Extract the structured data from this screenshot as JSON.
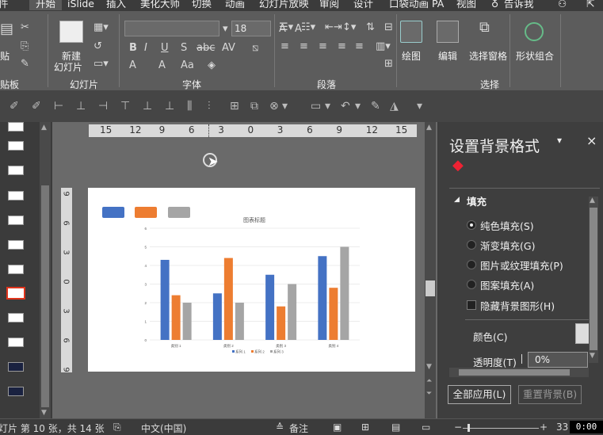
{
  "tabs": [
    "件",
    "开始",
    "iSlide",
    "插入",
    "美化大师",
    "切换",
    "动画",
    "幻灯片放映",
    "审阅",
    "设计",
    "口袋动画 PA",
    "视图",
    "告诉我"
  ],
  "ribbon": {
    "clipboard": {
      "paste": "贴",
      "label": "贴板"
    },
    "slides": {
      "new_slide": "新建",
      "new_slide2": "幻灯片",
      "label": "幻灯片"
    },
    "font": {
      "size": "18",
      "label": "字体",
      "bold": "B",
      "italic": "I",
      "underline": "U",
      "shadow": "S",
      "strike": "abc",
      "spacing": "AV",
      "case": "Aa",
      "color_a": "A",
      "grow": "A",
      "shrink": "A"
    },
    "paragraph": {
      "label": "段落"
    },
    "drawing": {
      "draw": "绘图",
      "edit": "编辑",
      "select_pane": "选择窗格",
      "group": "形状组合",
      "label": "选择"
    }
  },
  "ruler": {
    "h_ticks": [
      "15",
      "12",
      "9",
      "6",
      "3",
      "0",
      "3",
      "6",
      "9",
      "12",
      "15"
    ],
    "v_ticks": [
      "9",
      "6",
      "3",
      "0",
      "3",
      "6",
      "9"
    ]
  },
  "slide": {
    "legend_swatch_colors": [
      "#4472c4",
      "#ed7d31",
      "#a5a5a5"
    ]
  },
  "chart_data": {
    "type": "bar",
    "title": "图表标题",
    "categories": [
      "类别 1",
      "类别 2",
      "类别 3",
      "类别 4"
    ],
    "series": [
      {
        "name": "系列 1",
        "values": [
          4.3,
          2.5,
          3.5,
          4.5
        ],
        "color": "#4472c4"
      },
      {
        "name": "系列 2",
        "values": [
          2.4,
          4.4,
          1.8,
          2.8
        ],
        "color": "#ed7d31"
      },
      {
        "name": "系列 3",
        "values": [
          2,
          2,
          3,
          5
        ],
        "color": "#a5a5a5"
      }
    ],
    "yticks": [
      "0",
      "1",
      "2",
      "3",
      "4",
      "5",
      "6"
    ],
    "ylim": [
      0,
      6
    ],
    "grid": true,
    "legend": "bottom"
  },
  "panel": {
    "title": "设置背景格式",
    "section": "填充",
    "options": [
      "纯色填充(S)",
      "渐变填充(G)",
      "图片或纹理填充(P)",
      "图案填充(A)"
    ],
    "hide_bg": "隐藏背景图形(H)",
    "color_label": "颜色(C)",
    "transparency_label": "透明度(T)",
    "transparency_value": "0%",
    "apply_all": "全部应用(L)",
    "reset_bg": "重置背景(B)",
    "close": "×"
  },
  "status": {
    "slide_info": "灯片 第 10 张，共 14 张",
    "language": "中文(中国)",
    "notes": "备注",
    "zoom": "33",
    "clock": "0:00"
  }
}
